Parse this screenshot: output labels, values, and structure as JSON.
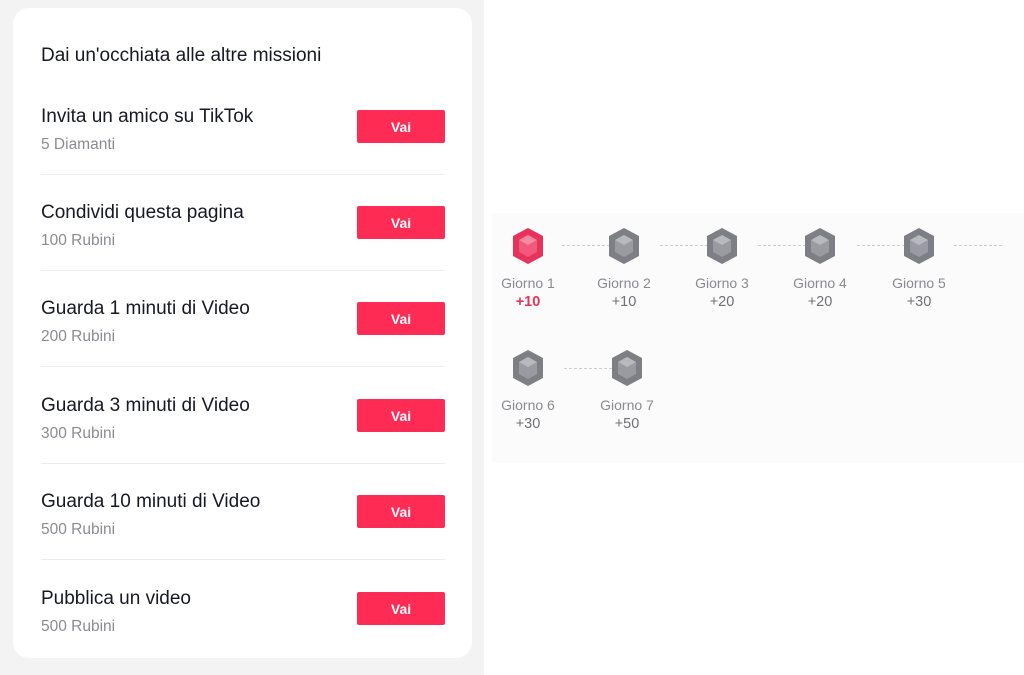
{
  "missions_panel": {
    "title": "Dai un'occhiata alle altre missioni",
    "missions": [
      {
        "name": "Invita un amico su TikTok",
        "reward": "5 Diamanti",
        "button": "Vai"
      },
      {
        "name": "Condividi questa pagina",
        "reward": "100 Rubini",
        "button": "Vai"
      },
      {
        "name": "Guarda 1 minuti di Video",
        "reward": "200 Rubini",
        "button": "Vai"
      },
      {
        "name": "Guarda 3 minuti di Video",
        "reward": "300 Rubini",
        "button": "Vai"
      },
      {
        "name": "Guarda 10 minuti di Video",
        "reward": "500 Rubini",
        "button": "Vai"
      },
      {
        "name": "Pubblica un video",
        "reward": "500 Rubini",
        "button": "Vai"
      }
    ]
  },
  "streak": {
    "days": [
      {
        "label": "Giorno 1",
        "points": "+10",
        "active": true,
        "icon": "ruby-gem-icon"
      },
      {
        "label": "Giorno 2",
        "points": "+10",
        "active": false,
        "icon": "gray-gem-icon"
      },
      {
        "label": "Giorno 3",
        "points": "+20",
        "active": false,
        "icon": "gray-gem-icon"
      },
      {
        "label": "Giorno 4",
        "points": "+20",
        "active": false,
        "icon": "gray-gem-icon"
      },
      {
        "label": "Giorno 5",
        "points": "+30",
        "active": false,
        "icon": "gray-gem-icon"
      },
      {
        "label": "Giorno 6",
        "points": "+30",
        "active": false,
        "icon": "gray-gem-icon"
      },
      {
        "label": "Giorno 7",
        "points": "+50",
        "active": false,
        "icon": "gray-gem-icon"
      }
    ]
  },
  "colors": {
    "accent": "#fe2c55",
    "active_gem": "#e8325a",
    "inactive_gem": "#8e8e93"
  }
}
